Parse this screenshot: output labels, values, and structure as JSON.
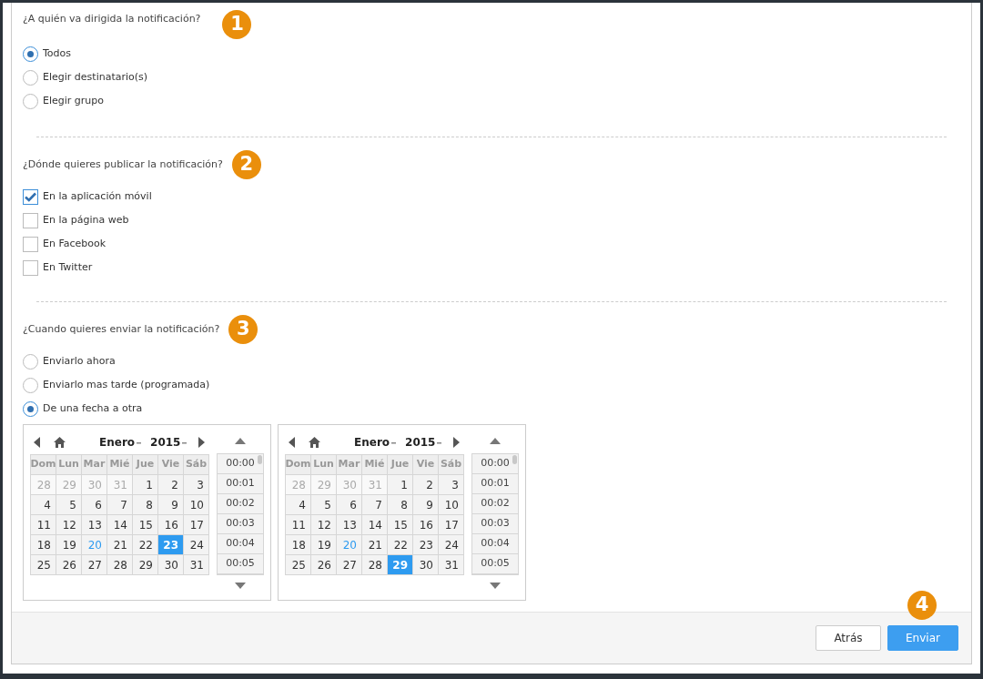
{
  "sections": [
    {
      "question": "¿A quién va dirigida la notificación?",
      "badge": "1",
      "options": [
        {
          "kind": "radio",
          "label": "Todos",
          "selected": true
        },
        {
          "kind": "radio",
          "label": "Elegir destinatario(s)",
          "selected": false
        },
        {
          "kind": "radio",
          "label": "Elegir grupo",
          "selected": false
        }
      ]
    },
    {
      "question": "¿Dónde quieres publicar la notificación?",
      "badge": "2",
      "options": [
        {
          "kind": "checkbox",
          "label": "En la aplicación móvil",
          "checked": true
        },
        {
          "kind": "checkbox",
          "label": "En la página web",
          "checked": false
        },
        {
          "kind": "checkbox",
          "label": "En Facebook",
          "checked": false
        },
        {
          "kind": "checkbox",
          "label": "En Twitter",
          "checked": false
        }
      ]
    },
    {
      "question": "¿Cuando quieres enviar la notificación?",
      "badge": "3",
      "options": [
        {
          "kind": "radio",
          "label": "Enviarlo ahora",
          "selected": false
        },
        {
          "kind": "radio",
          "label": "Enviarlo mas tarde (programada)",
          "selected": false
        },
        {
          "kind": "radio",
          "label": "De una fecha a otra",
          "selected": true
        }
      ],
      "calendars": [
        {
          "month": "Enero",
          "year": "2015",
          "weekdays": [
            "Dom",
            "Lun",
            "Mar",
            "Mié",
            "Jue",
            "Vie",
            "Sáb"
          ],
          "times": [
            "00:00",
            "00:01",
            "00:02",
            "00:03",
            "00:04",
            "00:05"
          ],
          "days": [
            {
              "label": "28",
              "kind": "outside",
              "selected": false
            },
            {
              "label": "29",
              "kind": "outside",
              "selected": false
            },
            {
              "label": "30",
              "kind": "outside",
              "selected": false
            },
            {
              "label": "31",
              "kind": "outside",
              "selected": false
            },
            {
              "label": "1",
              "kind": "day",
              "selected": false
            },
            {
              "label": "2",
              "kind": "day",
              "selected": false
            },
            {
              "label": "3",
              "kind": "day",
              "selected": false
            },
            {
              "label": "4",
              "kind": "day",
              "selected": false
            },
            {
              "label": "5",
              "kind": "day",
              "selected": false
            },
            {
              "label": "6",
              "kind": "day",
              "selected": false
            },
            {
              "label": "7",
              "kind": "day",
              "selected": false
            },
            {
              "label": "8",
              "kind": "day",
              "selected": false
            },
            {
              "label": "9",
              "kind": "day",
              "selected": false
            },
            {
              "label": "10",
              "kind": "day",
              "selected": false
            },
            {
              "label": "11",
              "kind": "day",
              "selected": false
            },
            {
              "label": "12",
              "kind": "day",
              "selected": false
            },
            {
              "label": "13",
              "kind": "day",
              "selected": false
            },
            {
              "label": "14",
              "kind": "day",
              "selected": false
            },
            {
              "label": "15",
              "kind": "day",
              "selected": false
            },
            {
              "label": "16",
              "kind": "day",
              "selected": false
            },
            {
              "label": "17",
              "kind": "day",
              "selected": false
            },
            {
              "label": "18",
              "kind": "day",
              "selected": false
            },
            {
              "label": "19",
              "kind": "day",
              "selected": false
            },
            {
              "label": "20",
              "kind": "today",
              "selected": false
            },
            {
              "label": "21",
              "kind": "day",
              "selected": false
            },
            {
              "label": "22",
              "kind": "day",
              "selected": false
            },
            {
              "label": "23",
              "kind": "day",
              "selected": true
            },
            {
              "label": "24",
              "kind": "day",
              "selected": false
            },
            {
              "label": "25",
              "kind": "day",
              "selected": false
            },
            {
              "label": "26",
              "kind": "day",
              "selected": false
            },
            {
              "label": "27",
              "kind": "day",
              "selected": false
            },
            {
              "label": "28",
              "kind": "day",
              "selected": false
            },
            {
              "label": "29",
              "kind": "day",
              "selected": false
            },
            {
              "label": "30",
              "kind": "day",
              "selected": false
            },
            {
              "label": "31",
              "kind": "day",
              "selected": false
            }
          ]
        },
        {
          "month": "Enero",
          "year": "2015",
          "weekdays": [
            "Dom",
            "Lun",
            "Mar",
            "Mié",
            "Jue",
            "Vie",
            "Sáb"
          ],
          "times": [
            "00:00",
            "00:01",
            "00:02",
            "00:03",
            "00:04",
            "00:05"
          ],
          "days": [
            {
              "label": "28",
              "kind": "outside",
              "selected": false
            },
            {
              "label": "29",
              "kind": "outside",
              "selected": false
            },
            {
              "label": "30",
              "kind": "outside",
              "selected": false
            },
            {
              "label": "31",
              "kind": "outside",
              "selected": false
            },
            {
              "label": "1",
              "kind": "day",
              "selected": false
            },
            {
              "label": "2",
              "kind": "day",
              "selected": false
            },
            {
              "label": "3",
              "kind": "day",
              "selected": false
            },
            {
              "label": "4",
              "kind": "day",
              "selected": false
            },
            {
              "label": "5",
              "kind": "day",
              "selected": false
            },
            {
              "label": "6",
              "kind": "day",
              "selected": false
            },
            {
              "label": "7",
              "kind": "day",
              "selected": false
            },
            {
              "label": "8",
              "kind": "day",
              "selected": false
            },
            {
              "label": "9",
              "kind": "day",
              "selected": false
            },
            {
              "label": "10",
              "kind": "day",
              "selected": false
            },
            {
              "label": "11",
              "kind": "day",
              "selected": false
            },
            {
              "label": "12",
              "kind": "day",
              "selected": false
            },
            {
              "label": "13",
              "kind": "day",
              "selected": false
            },
            {
              "label": "14",
              "kind": "day",
              "selected": false
            },
            {
              "label": "15",
              "kind": "day",
              "selected": false
            },
            {
              "label": "16",
              "kind": "day",
              "selected": false
            },
            {
              "label": "17",
              "kind": "day",
              "selected": false
            },
            {
              "label": "18",
              "kind": "day",
              "selected": false
            },
            {
              "label": "19",
              "kind": "day",
              "selected": false
            },
            {
              "label": "20",
              "kind": "today",
              "selected": false
            },
            {
              "label": "21",
              "kind": "day",
              "selected": false
            },
            {
              "label": "22",
              "kind": "day",
              "selected": false
            },
            {
              "label": "23",
              "kind": "day",
              "selected": false
            },
            {
              "label": "24",
              "kind": "day",
              "selected": false
            },
            {
              "label": "25",
              "kind": "day",
              "selected": false
            },
            {
              "label": "26",
              "kind": "day",
              "selected": false
            },
            {
              "label": "27",
              "kind": "day",
              "selected": false
            },
            {
              "label": "28",
              "kind": "day",
              "selected": false
            },
            {
              "label": "29",
              "kind": "day",
              "selected": true
            },
            {
              "label": "30",
              "kind": "day",
              "selected": false
            },
            {
              "label": "31",
              "kind": "day",
              "selected": false
            }
          ]
        }
      ]
    }
  ],
  "footer": {
    "badge": "4",
    "buttons": [
      {
        "label": "Atrás",
        "kind": "secondary"
      },
      {
        "label": "Enviar",
        "kind": "primary"
      }
    ]
  }
}
